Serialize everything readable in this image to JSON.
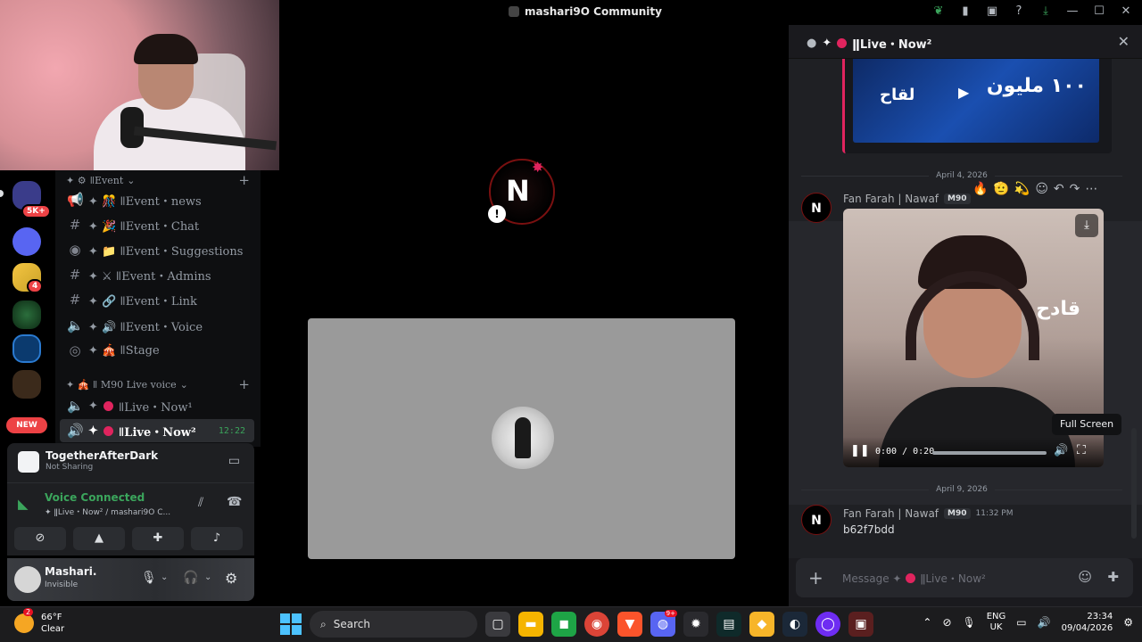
{
  "window": {
    "title": "mashari9O Community"
  },
  "colors": {
    "accent": "#5865f2",
    "live_dot": "#e0245e",
    "online": "#3ba55c",
    "badge": "#ed4245"
  },
  "servers": {
    "badge_top": "5K+",
    "badge_mid": "4",
    "new_label": "NEW"
  },
  "channels": {
    "event_category": "ǁEvent",
    "items": [
      {
        "label": "✦ 🎊 ǁEvent・news"
      },
      {
        "label": "✦ 🎉 ǁEvent・Chat"
      },
      {
        "label": "✦ 📁 ǁEvent・Suggestions"
      },
      {
        "label": "✦ ⚔ ǁEvent・Admins"
      },
      {
        "label": "✦ 🔗 ǁEvent・Link"
      },
      {
        "label": "✦ 🔊 ǁEvent・Voice"
      },
      {
        "label": "✦ 🎪 ǁStage"
      }
    ],
    "live_category": "✦ 🎪 ǁ M90 Live voice",
    "live1": "ǁLive・Now¹",
    "live2": "ǁLive・Now²",
    "live2_time": "12:22"
  },
  "activity": {
    "name": "TogetherAfterDark",
    "status": "Not Sharing"
  },
  "voice": {
    "status": "Voice Connected",
    "channel": "✦ ǁLive・Now² / mashari9O C..."
  },
  "user": {
    "name": "Mashari.",
    "status": "Invisible"
  },
  "chat": {
    "header": "ǁLive・Now²",
    "date1": "April 4, 2026",
    "author": "Fan Farah | Nawaf",
    "tag": "M90",
    "video": {
      "time": "0:00 / 0:20",
      "progress": 0.0
    },
    "tooltip": "Full Screen",
    "date2": "April 9, 2026",
    "msg2_time": "11:32 PM",
    "msg2_text": "b62f7bdd",
    "placeholder": "Message ✦",
    "placeholder_channel": "ǁLive・Now²",
    "embed_text_right": "١٠٠ مليون",
    "embed_text_left": "لقاح",
    "video_text": "قادح"
  },
  "taskbar": {
    "temp": "66°F",
    "weather": "Clear",
    "weather_badge": "2",
    "search": "Search",
    "discord_badge": "9+",
    "lang1": "ENG",
    "lang2": "UK",
    "time": "23:34",
    "date": "09/04/2026"
  }
}
